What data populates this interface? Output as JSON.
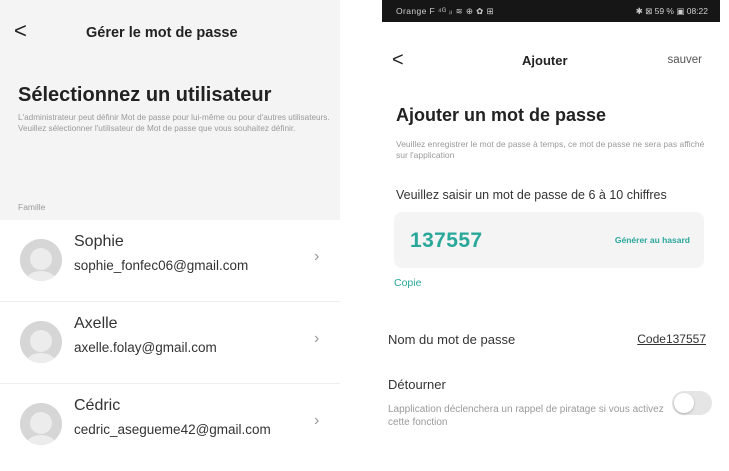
{
  "left": {
    "header": {
      "back_icon": "chevron-left-icon",
      "title": "Gérer le mot de passe"
    },
    "heading": "Sélectionnez un utilisateur",
    "description": "L'administrateur peut définir Mot de passe pour lui-même ou pour d'autres utilisateurs. Veuillez sélectionner l'utilisateur de Mot de passe que vous souhaitez définir.",
    "section_label": "Famille",
    "users": [
      {
        "name": "Sophie",
        "email": "sophie_fonfec06@gmail.com"
      },
      {
        "name": "Axelle",
        "email": "axelle.folay@gmail.com"
      },
      {
        "name": "Cédric",
        "email": "cedric_asegueme42@gmail.com"
      }
    ]
  },
  "right": {
    "status_bar": {
      "left": "Orange F ⁴ᴳ ᵢₗ ≋ ⊕ ✿ ⊞",
      "right": "✱ ⊠ 59 % ▣ 08:22"
    },
    "header": {
      "back_icon": "chevron-left-icon",
      "title": "Ajouter",
      "save_label": "sauver"
    },
    "heading": "Ajouter un mot de passe",
    "description": "Veuillez enregistrer le mot de passe à temps, ce mot de passe ne sera pas affiché sur l'application",
    "prompt": "Veuillez saisir un mot de passe de 6 à 10 chiffres",
    "password_value": "137557",
    "generate_label": "Générer au hasard",
    "copy_label": "Copie",
    "name_label": "Nom du mot de passe",
    "name_value": "Code137557",
    "divert_label": "Détourner",
    "divert_description": "Lapplication déclenchera un rappel de piratage si vous activez cette fonction",
    "divert_enabled": false
  },
  "colors": {
    "accent": "#2aa79b",
    "muted_text": "#9a9a9a",
    "panel_bg": "#f4f4f4",
    "status_bar_bg": "#161616"
  }
}
